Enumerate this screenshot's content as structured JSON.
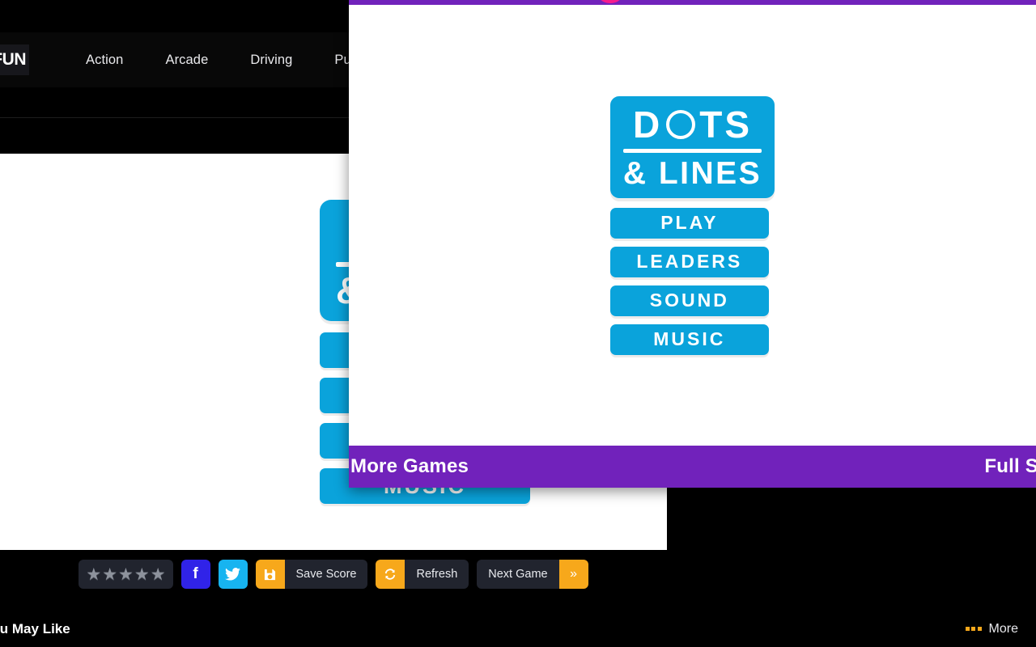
{
  "site": {
    "brand": "FUN",
    "nav": [
      {
        "label": "Action"
      },
      {
        "label": "Arcade"
      },
      {
        "label": "Driving"
      },
      {
        "label": "Pu"
      }
    ]
  },
  "game": {
    "title_top": "DOTS",
    "title_top_a": "D",
    "title_top_o": "O",
    "title_top_b": "TS",
    "title_bottom": "& LINES",
    "menu": [
      {
        "label": "PLAY"
      },
      {
        "label": "LEADERS"
      },
      {
        "label": "SOUND"
      },
      {
        "label": "MUSIC"
      }
    ],
    "logo_color": "#0AA3DB"
  },
  "toolbar": {
    "stars": [
      "★",
      "★",
      "★",
      "★",
      "★"
    ],
    "facebook_icon": "f",
    "twitter_icon": "🐦",
    "save_icon": "💾",
    "save_label": "Save Score",
    "refresh_icon": "↻",
    "refresh_label": "Refresh",
    "next_label": "Next Game",
    "next_icon": "»",
    "accent_color": "#F7A81B"
  },
  "likes": {
    "title": "es You May Like",
    "more_label": "More"
  },
  "overlay": {
    "bar_color": "#7122BB",
    "marker_color": "#F61C8C",
    "more_games_label": "More Games",
    "full_screen_label": "Full Screen"
  }
}
